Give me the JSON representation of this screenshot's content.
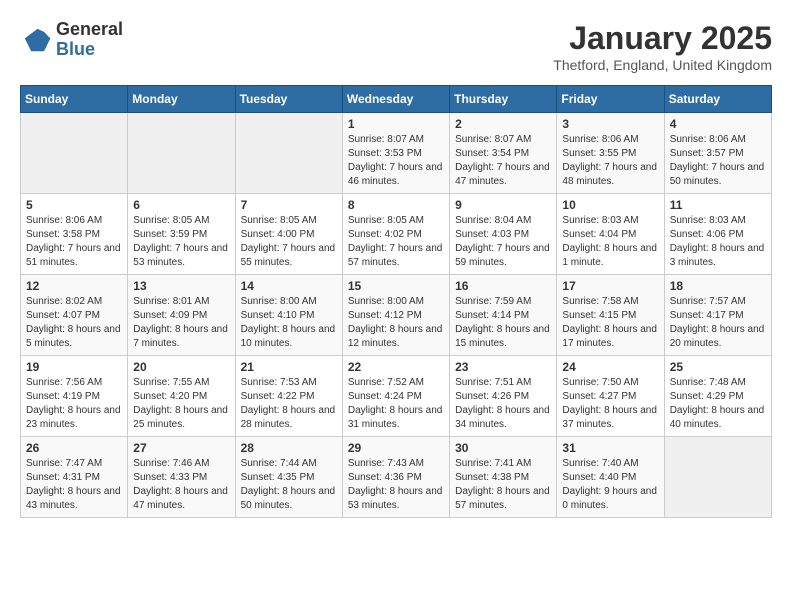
{
  "header": {
    "logo_general": "General",
    "logo_blue": "Blue",
    "month_title": "January 2025",
    "location": "Thetford, England, United Kingdom"
  },
  "days_of_week": [
    "Sunday",
    "Monday",
    "Tuesday",
    "Wednesday",
    "Thursday",
    "Friday",
    "Saturday"
  ],
  "weeks": [
    [
      {
        "day": "",
        "info": ""
      },
      {
        "day": "",
        "info": ""
      },
      {
        "day": "",
        "info": ""
      },
      {
        "day": "1",
        "info": "Sunrise: 8:07 AM\nSunset: 3:53 PM\nDaylight: 7 hours and 46 minutes."
      },
      {
        "day": "2",
        "info": "Sunrise: 8:07 AM\nSunset: 3:54 PM\nDaylight: 7 hours and 47 minutes."
      },
      {
        "day": "3",
        "info": "Sunrise: 8:06 AM\nSunset: 3:55 PM\nDaylight: 7 hours and 48 minutes."
      },
      {
        "day": "4",
        "info": "Sunrise: 8:06 AM\nSunset: 3:57 PM\nDaylight: 7 hours and 50 minutes."
      }
    ],
    [
      {
        "day": "5",
        "info": "Sunrise: 8:06 AM\nSunset: 3:58 PM\nDaylight: 7 hours and 51 minutes."
      },
      {
        "day": "6",
        "info": "Sunrise: 8:05 AM\nSunset: 3:59 PM\nDaylight: 7 hours and 53 minutes."
      },
      {
        "day": "7",
        "info": "Sunrise: 8:05 AM\nSunset: 4:00 PM\nDaylight: 7 hours and 55 minutes."
      },
      {
        "day": "8",
        "info": "Sunrise: 8:05 AM\nSunset: 4:02 PM\nDaylight: 7 hours and 57 minutes."
      },
      {
        "day": "9",
        "info": "Sunrise: 8:04 AM\nSunset: 4:03 PM\nDaylight: 7 hours and 59 minutes."
      },
      {
        "day": "10",
        "info": "Sunrise: 8:03 AM\nSunset: 4:04 PM\nDaylight: 8 hours and 1 minute."
      },
      {
        "day": "11",
        "info": "Sunrise: 8:03 AM\nSunset: 4:06 PM\nDaylight: 8 hours and 3 minutes."
      }
    ],
    [
      {
        "day": "12",
        "info": "Sunrise: 8:02 AM\nSunset: 4:07 PM\nDaylight: 8 hours and 5 minutes."
      },
      {
        "day": "13",
        "info": "Sunrise: 8:01 AM\nSunset: 4:09 PM\nDaylight: 8 hours and 7 minutes."
      },
      {
        "day": "14",
        "info": "Sunrise: 8:00 AM\nSunset: 4:10 PM\nDaylight: 8 hours and 10 minutes."
      },
      {
        "day": "15",
        "info": "Sunrise: 8:00 AM\nSunset: 4:12 PM\nDaylight: 8 hours and 12 minutes."
      },
      {
        "day": "16",
        "info": "Sunrise: 7:59 AM\nSunset: 4:14 PM\nDaylight: 8 hours and 15 minutes."
      },
      {
        "day": "17",
        "info": "Sunrise: 7:58 AM\nSunset: 4:15 PM\nDaylight: 8 hours and 17 minutes."
      },
      {
        "day": "18",
        "info": "Sunrise: 7:57 AM\nSunset: 4:17 PM\nDaylight: 8 hours and 20 minutes."
      }
    ],
    [
      {
        "day": "19",
        "info": "Sunrise: 7:56 AM\nSunset: 4:19 PM\nDaylight: 8 hours and 23 minutes."
      },
      {
        "day": "20",
        "info": "Sunrise: 7:55 AM\nSunset: 4:20 PM\nDaylight: 8 hours and 25 minutes."
      },
      {
        "day": "21",
        "info": "Sunrise: 7:53 AM\nSunset: 4:22 PM\nDaylight: 8 hours and 28 minutes."
      },
      {
        "day": "22",
        "info": "Sunrise: 7:52 AM\nSunset: 4:24 PM\nDaylight: 8 hours and 31 minutes."
      },
      {
        "day": "23",
        "info": "Sunrise: 7:51 AM\nSunset: 4:26 PM\nDaylight: 8 hours and 34 minutes."
      },
      {
        "day": "24",
        "info": "Sunrise: 7:50 AM\nSunset: 4:27 PM\nDaylight: 8 hours and 37 minutes."
      },
      {
        "day": "25",
        "info": "Sunrise: 7:48 AM\nSunset: 4:29 PM\nDaylight: 8 hours and 40 minutes."
      }
    ],
    [
      {
        "day": "26",
        "info": "Sunrise: 7:47 AM\nSunset: 4:31 PM\nDaylight: 8 hours and 43 minutes."
      },
      {
        "day": "27",
        "info": "Sunrise: 7:46 AM\nSunset: 4:33 PM\nDaylight: 8 hours and 47 minutes."
      },
      {
        "day": "28",
        "info": "Sunrise: 7:44 AM\nSunset: 4:35 PM\nDaylight: 8 hours and 50 minutes."
      },
      {
        "day": "29",
        "info": "Sunrise: 7:43 AM\nSunset: 4:36 PM\nDaylight: 8 hours and 53 minutes."
      },
      {
        "day": "30",
        "info": "Sunrise: 7:41 AM\nSunset: 4:38 PM\nDaylight: 8 hours and 57 minutes."
      },
      {
        "day": "31",
        "info": "Sunrise: 7:40 AM\nSunset: 4:40 PM\nDaylight: 9 hours and 0 minutes."
      },
      {
        "day": "",
        "info": ""
      }
    ]
  ]
}
